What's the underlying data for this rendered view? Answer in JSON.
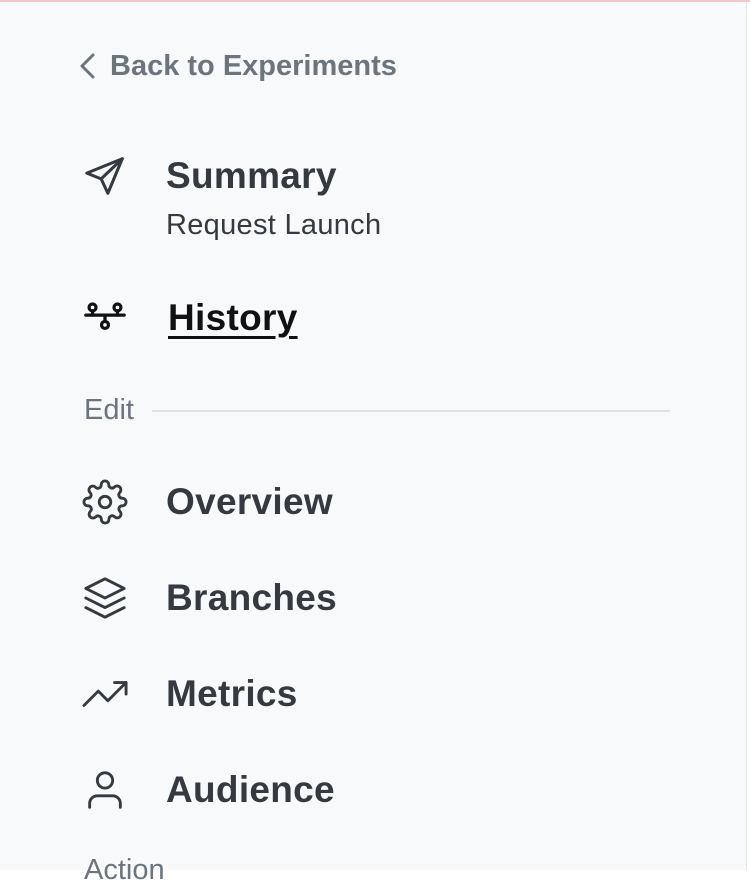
{
  "nav": {
    "back_label": "Back to Experiments",
    "summary": {
      "label": "Summary",
      "sublabel": "Request Launch",
      "icon": "paper-plane-icon"
    },
    "history": {
      "label": "History",
      "icon": "git-branch-icon"
    }
  },
  "edit_section": {
    "title": "Edit",
    "items": [
      {
        "label": "Overview",
        "icon": "gear-icon"
      },
      {
        "label": "Branches",
        "icon": "layers-icon"
      },
      {
        "label": "Metrics",
        "icon": "trending-up-icon"
      },
      {
        "label": "Audience",
        "icon": "person-icon"
      }
    ]
  },
  "action_section": {
    "title": "Action"
  },
  "colors": {
    "sidebar_bg": "#f8f9fa",
    "text_primary": "#343a40",
    "text_muted": "#6c757d",
    "top_accent": "#f3c7c9"
  }
}
